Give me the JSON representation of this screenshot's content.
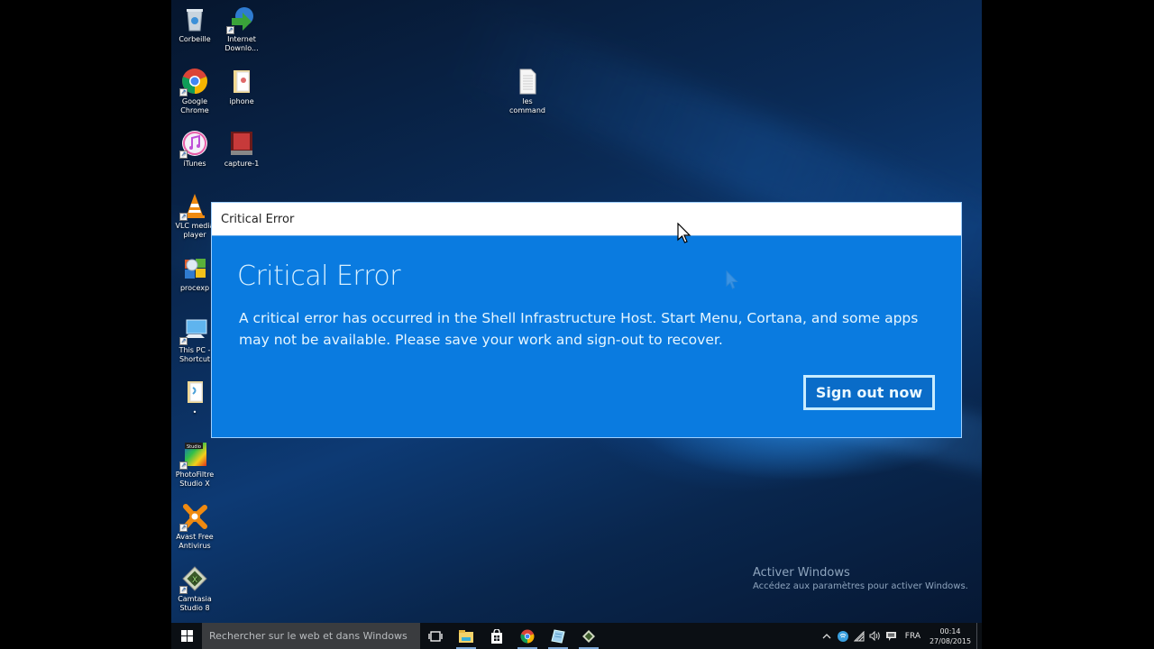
{
  "desktop": {
    "icons": [
      {
        "label": "Corbeille",
        "icon": "recycle-bin-icon",
        "shortcut": false
      },
      {
        "label": "Internet Downlo...",
        "icon": "internet-download-manager-icon",
        "shortcut": true
      },
      {
        "label": "Google Chrome",
        "icon": "chrome-icon",
        "shortcut": true
      },
      {
        "label": "iphone",
        "icon": "folder-icon",
        "shortcut": false
      },
      {
        "label": "iTunes",
        "icon": "itunes-icon",
        "shortcut": true
      },
      {
        "label": "capture-1",
        "icon": "video-file-icon",
        "shortcut": false
      },
      {
        "label": "VLC media player",
        "icon": "vlc-icon",
        "shortcut": true
      },
      {
        "label": "procexp",
        "icon": "procexp-icon",
        "shortcut": false
      },
      {
        "label": "This PC - Shortcut",
        "icon": "this-pc-icon",
        "shortcut": true
      },
      {
        "label": "•",
        "icon": "folder-icon",
        "shortcut": false
      },
      {
        "label": "PhotoFiltre Studio X",
        "icon": "photofiltre-icon",
        "shortcut": true
      },
      {
        "label": "Avast Free Antivirus",
        "icon": "avast-icon",
        "shortcut": true
      },
      {
        "label": "Camtasia Studio 8",
        "icon": "camtasia-icon",
        "shortcut": true
      },
      {
        "label": "les command",
        "icon": "text-file-icon",
        "shortcut": false
      }
    ]
  },
  "dialog": {
    "window_title": "Critical Error",
    "heading": "Critical Error",
    "message": "A critical error has occurred in the Shell Infrastructure Host. Start Menu, Cortana, and some apps may not be available.  Please save your work and sign-out to recover.",
    "button_label": "Sign out now",
    "accent_color": "#0a7be0"
  },
  "watermark": {
    "title": "Activer Windows",
    "subtitle": "Accédez aux paramètres pour activer Windows."
  },
  "taskbar": {
    "search_placeholder": "Rechercher sur le web et dans Windows",
    "pinned": [
      {
        "name": "task-view",
        "running": false
      },
      {
        "name": "file-explorer",
        "running": true
      },
      {
        "name": "store",
        "running": false
      },
      {
        "name": "chrome",
        "running": true
      },
      {
        "name": "notepad",
        "running": true
      },
      {
        "name": "camtasia",
        "running": true
      }
    ],
    "tray": {
      "language": "FRA",
      "time": "00:14",
      "date": "27/08/2015"
    }
  }
}
